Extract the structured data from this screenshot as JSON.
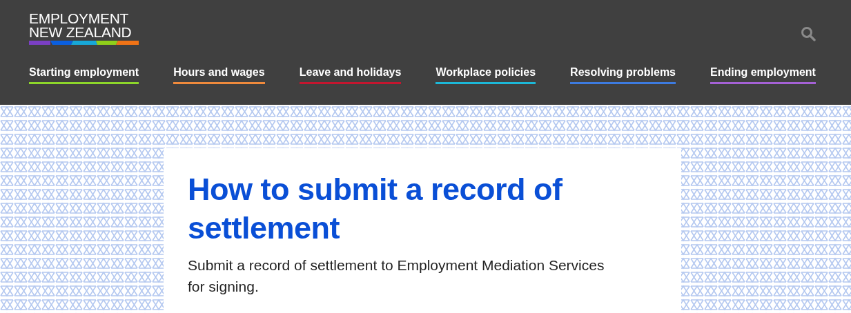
{
  "logo": {
    "lines": [
      "EMPLOYMENT",
      "NEW ZEALAND"
    ]
  },
  "nav": [
    {
      "label": "Starting employment",
      "color": "#8dd62a"
    },
    {
      "label": "Hours and wages",
      "color": "#f08a3c"
    },
    {
      "label": "Leave and holidays",
      "color": "#c4162f"
    },
    {
      "label": "Workplace policies",
      "color": "#1cb8d8"
    },
    {
      "label": "Resolving problems",
      "color": "#3d7be0"
    },
    {
      "label": "Ending employment",
      "color": "#a561d6"
    }
  ],
  "page": {
    "title": "How to submit a record of settlement",
    "summary": "Submit a record of settlement to Employment Mediation Services for signing."
  }
}
